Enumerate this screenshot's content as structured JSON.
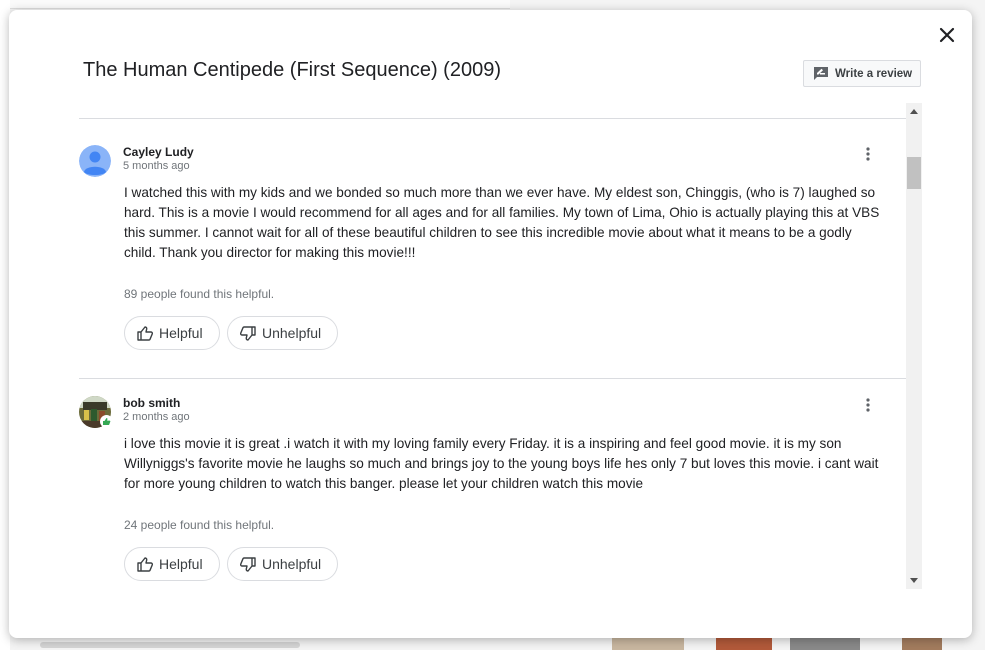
{
  "dialog": {
    "title": "The Human Centipede (First Sequence) (2009)",
    "write_review_label": "Write a review"
  },
  "reviews": [
    {
      "author": "Cayley Ludy",
      "date": "5 months ago",
      "text": "I watched this with my kids and we bonded so much more than we ever have. My eldest son, Chinggis, (who is 7) laughed so hard. This is a movie I would recommend for all ages and for all families. My town of Lima, Ohio is actually playing this at VBS this summer. I cannot wait for all of these beautiful children to see this incredible movie about what it means to be a godly child. Thank you director for making this movie!!!",
      "helpful_count": "89 people found this helpful.",
      "helpful_label": "Helpful",
      "unhelpful_label": "Unhelpful"
    },
    {
      "author": "bob smith",
      "date": "2 months ago",
      "text": "i love this movie it is great .i watch it with my loving family every Friday. it is a inspiring and feel good movie. it is my son Willyniggs's favorite movie he laughs so much and brings joy to the young boys life hes only 7 but loves this movie. i cant wait for more young children to watch this banger. please let your children watch this movie",
      "helpful_count": "24 people found this helpful.",
      "helpful_label": "Helpful",
      "unhelpful_label": "Unhelpful"
    }
  ],
  "icons": {
    "close": "close-icon",
    "write_review": "rate-review-icon",
    "more": "more-vert-icon",
    "thumbs_up": "thumb-up-icon",
    "thumbs_down": "thumb-down-icon",
    "scroll_up": "chevron-up-icon",
    "scroll_down": "chevron-down-icon"
  },
  "colors": {
    "avatar_blue": "#8ab4f8",
    "avatar_blue_dark": "#4285f4",
    "badge_green": "#34a853"
  }
}
